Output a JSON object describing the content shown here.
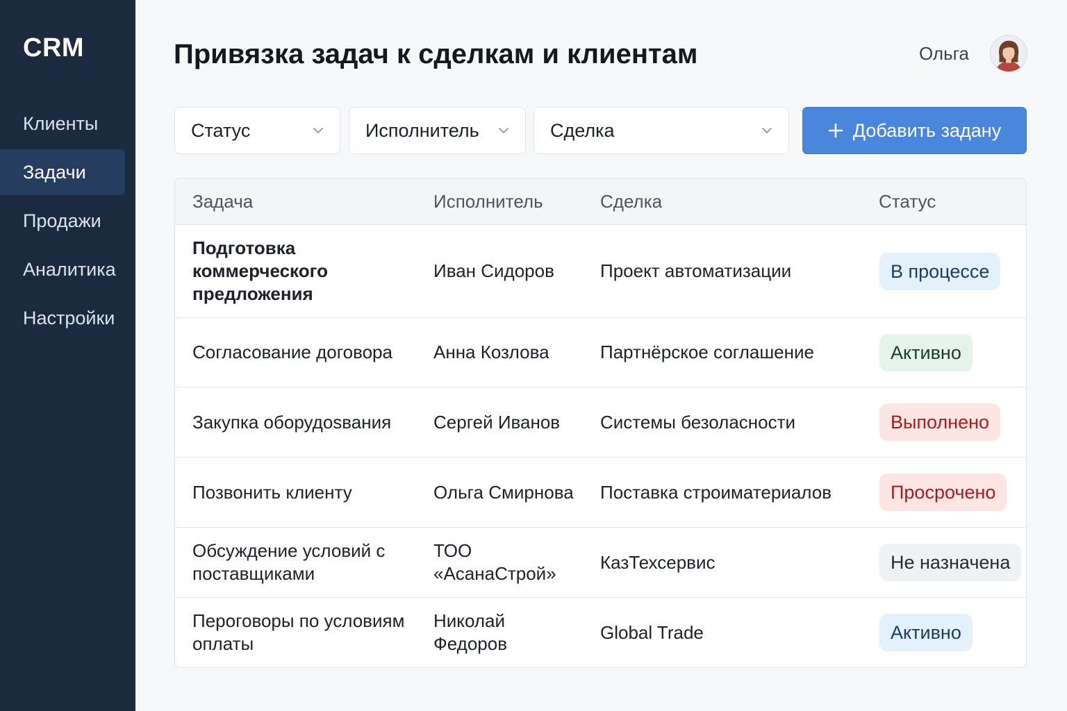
{
  "app": {
    "logo": "CRM"
  },
  "sidebar": {
    "items": [
      {
        "label": "Клиенты",
        "active": false
      },
      {
        "label": "Задачи",
        "active": true
      },
      {
        "label": "Продажи",
        "active": false
      },
      {
        "label": "Аналитика",
        "active": false
      },
      {
        "label": "Настройки",
        "active": false
      }
    ]
  },
  "header": {
    "title": "Привязка задач к сделкам и клиентам",
    "user_name": "Ольга"
  },
  "filters": {
    "status": "Статус",
    "assignee": "Исполнитель",
    "deal": "Сделка",
    "add_button": "Добавить задану"
  },
  "table": {
    "columns": [
      "Задача",
      "Исполнитель",
      "Сделка",
      "Статус"
    ],
    "rows": [
      {
        "task": "Подготовка коммерческого предложения",
        "assignee": "Иван Сидоров",
        "deal": "Проект автоматизации",
        "status": "В процессе"
      },
      {
        "task": "Согласование договора",
        "assignee": "Анна Козлова",
        "deal": "Партнёрское соглашение",
        "status": "Активно"
      },
      {
        "task": "Закупка оборудоsвания",
        "assignee": "Сергей Иванов",
        "deal": "Системы безоласности",
        "status": "Выполнено"
      },
      {
        "task": "Позвонить клиенту",
        "assignee": "Ольга Смирнова",
        "deal": "Поставка строиматериалов",
        "status": "Просрочено"
      },
      {
        "task": "Обсуждение условий с поставщиками",
        "assignee": "ТОО «АсанаСтрой»",
        "deal": "КазТехсервис",
        "status": "Не назначена"
      },
      {
        "task": "Перoговоры по условиям оплаты",
        "assignee": "Николай Федоров",
        "deal": "Global Trade",
        "status": "Активно"
      }
    ]
  },
  "colors": {
    "sidebar_bg": "#1c2a3f",
    "sidebar_active": "#263d5f",
    "primary_button": "#4a86dc",
    "badge_blue": "#e3f1fd",
    "badge_green": "#e4f4ea",
    "badge_red": "#fde5e3",
    "badge_gray": "#f0f1f3"
  },
  "icons": {
    "filter_chevron": "chevron-down-icon",
    "add": "plus-icon",
    "avatar": "avatar"
  }
}
